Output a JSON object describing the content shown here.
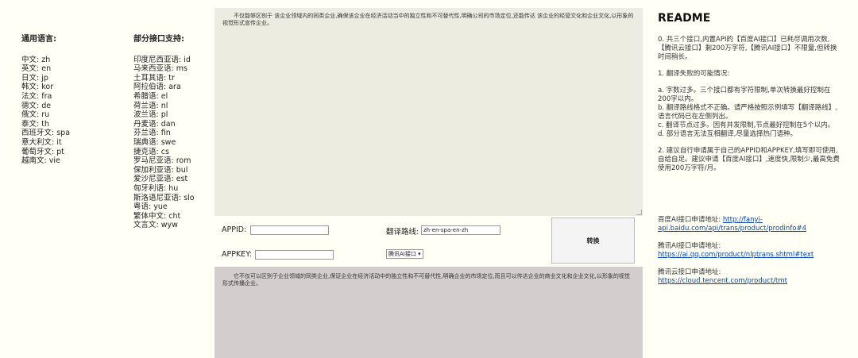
{
  "common_languages": {
    "title": "通用语言:",
    "items": [
      "中文: zh",
      "英文: en",
      "日文: jp",
      "韩文: kor",
      "法文: fra",
      "德文: de",
      "俄文: ru",
      "泰文: th",
      "西班牙文: spa",
      "意大利文: it",
      "葡萄牙文: pt",
      "越南文: vie"
    ]
  },
  "partial_languages": {
    "title": "部分接口支持:",
    "items": [
      "印度尼西亚语: id",
      "马来西亚语: ms",
      "土耳其语: tr",
      "阿拉伯语: ara",
      "希腊语: el",
      "荷兰语: nl",
      "波兰语: pl",
      "丹麦语: dan",
      "芬兰语: fin",
      "瑞典语: swe",
      "捷克语: cs",
      "罗马尼亚语: rom",
      "保加利亚语: bul",
      "爱沙尼亚语: est",
      "匈牙利语: hu",
      "斯洛语尼亚语: slo",
      "粤语: yue",
      "繁体中文: cht",
      "文言文: wyw"
    ]
  },
  "source_text": "不仅能够区别于 该企业领域内的同类企业,确保该企业在经济活动当中的独立性和不可替代性,明确公司的市场定位,还能传达 该企业的经营文化和企业文化,以形象的视觉形式宣传企业。",
  "controls": {
    "appid_label": "APPID:",
    "appid_value": "",
    "appkey_label": "APPKEY:",
    "appkey_value": "",
    "route_label": "翻译路线:",
    "route_value": "zh-en-spa-en-zh",
    "api_select": "腾讯AI接口",
    "convert_label": "转换"
  },
  "result_text": "它不仅可以区别于企业领域的同类企业,保证企业在经济活动中的独立性和不可替代性,明确企业的市场定位,而且可以传达企业的商业文化和企业文化,以形象的视觉形式传播企业。",
  "readme": {
    "title": "README",
    "p1": "0. 共三个接口,内置API的【百度AI接口】已耗尽调用次数,【腾讯云接口】剩200万字符,【腾讯AI接口】不限量,但转换时间稍长。",
    "p2": "1. 翻译失败的可能情况:",
    "p3a": "a. 字数过多。三个接口都有字符限制,单次转换最好控制在200字以内。",
    "p3b": "b. 翻译路线格式不正确。请严格按照示例填写【翻译路线】,语言代码已在左侧列出。",
    "p3c": "c. 翻译节点过多。因有并发限制,节点最好控制在5个以内。",
    "p3d": "d. 部分语言无法互相翻译,尽量选择热门语种。",
    "p4": "2. 建议自行申请属于自己的APPID和APPKEY,填写即可使用,自给自足。建议申请【百度AI接口】,速度快,限制少,最高免费使用200万字符/月。",
    "baidu_label": "百度AI接口申请地址:",
    "baidu_url_a": "http://fanyi-",
    "baidu_url_b": "api.baidu.com/api/trans/product/prodinfo#4",
    "tencent_ai_label": "腾讯AI接口申请地址:",
    "tencent_ai_url": "https://ai.qq.com/product/nlptrans.shtml#text",
    "tencent_cloud_label": "腾讯云接口申请地址:",
    "tencent_cloud_url": "https://cloud.tencent.com/product/tmt"
  }
}
